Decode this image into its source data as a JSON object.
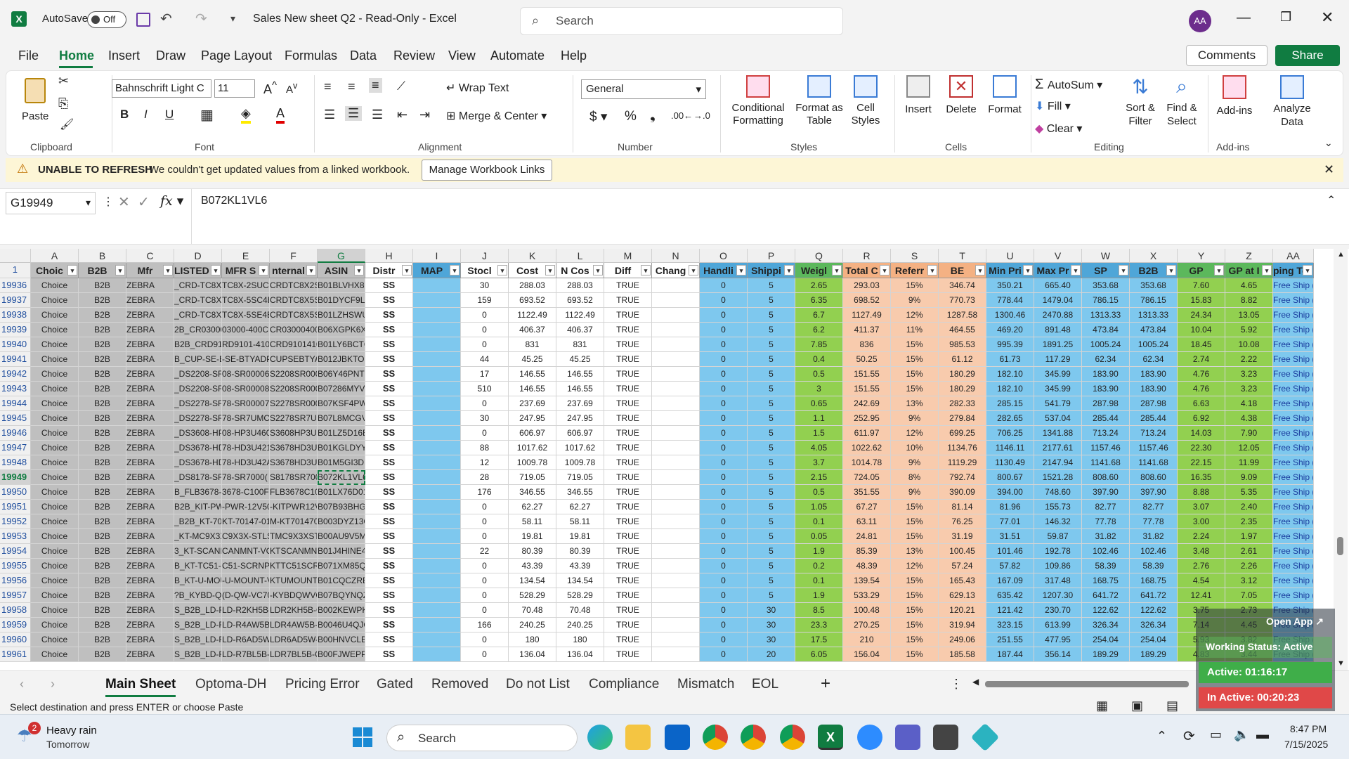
{
  "app": {
    "autosave": "AutoSave",
    "toggle": "Off",
    "title": "Sales New sheet Q2 - Read-Only - Excel",
    "search": "Search",
    "user": "AA"
  },
  "menu": [
    "File",
    "Home",
    "Insert",
    "Draw",
    "Page Layout",
    "Formulas",
    "Data",
    "Review",
    "View",
    "Automate",
    "Help"
  ],
  "comments": "Comments",
  "share": "Share",
  "ribbon": {
    "paste": "Paste",
    "clipboard": "Clipboard",
    "font_name": "Bahnschrift Light C",
    "font_size": "11",
    "font": "Font",
    "wrap": "Wrap Text",
    "merge": "Merge & Center",
    "alignment": "Alignment",
    "numfmt": "General",
    "number": "Number",
    "cond": "Conditional Formatting",
    "fmt_table": "Format as Table",
    "cell_styles": "Cell Styles",
    "styles": "Styles",
    "insert": "Insert",
    "delete": "Delete",
    "format": "Format",
    "cells": "Cells",
    "autosum": "AutoSum",
    "fill": "Fill",
    "clear": "Clear",
    "sort": "Sort & Filter",
    "find": "Find & Select",
    "editing": "Editing",
    "addins": "Add-ins",
    "addins_grp": "Add-ins",
    "analyze": "Analyze Data"
  },
  "warning": {
    "title": "UNABLE TO REFRESH",
    "msg": "We couldn't get updated values from a linked workbook.",
    "btn": "Manage Workbook Links"
  },
  "namebox": "G19949",
  "formula": "B072KL1VL6",
  "columns": [
    "A",
    "B",
    "C",
    "D",
    "E",
    "F",
    "G",
    "H",
    "I",
    "J",
    "K",
    "L",
    "M",
    "N",
    "O",
    "P",
    "Q",
    "R",
    "S",
    "T",
    "U",
    "V",
    "W",
    "X",
    "Y",
    "Z",
    "AA"
  ],
  "headers": [
    "Choic",
    "B2B",
    "Mfr",
    "LISTED SI",
    "MFR S",
    "nternal",
    "ASIN",
    "Distr",
    "MAP",
    "Stocl",
    "Cost",
    "N Cos",
    "Diff",
    "Chang",
    "Handli",
    "Shippi",
    "Weigl",
    "Total C",
    "Referr",
    "BE",
    "Min Pri",
    "Max Pr",
    "SP",
    "B2B",
    "GP",
    "GP at I",
    "ping Te"
  ],
  "rows": [
    [
      "19936",
      "Choice",
      "B2B",
      "ZEBRA",
      "_CRD-TC8X-2SU",
      "TC8X-2SUCH",
      "CRDTC8X2SUC",
      "B01BLVHX8S",
      "SS",
      "",
      "30",
      "288.03",
      "288.03",
      "TRUE",
      "",
      "0",
      "5",
      "2.65",
      "293.03",
      "15%",
      "346.74",
      "350.21",
      "665.40",
      "353.68",
      "353.68",
      "7.60",
      "4.65",
      "Free Ship ("
    ],
    [
      "19937",
      "Choice",
      "B2B",
      "ZEBRA",
      "_CRD-TC8X-5SC",
      "TC8X-5SC4E",
      "CRDTC8X5SC4",
      "B01DYCF9LK",
      "SS",
      "",
      "159",
      "693.52",
      "693.52",
      "TRUE",
      "",
      "0",
      "5",
      "6.35",
      "698.52",
      "9%",
      "770.73",
      "778.44",
      "1479.04",
      "786.15",
      "786.15",
      "15.83",
      "8.82",
      "Free Ship ("
    ],
    [
      "19938",
      "Choice",
      "B2B",
      "ZEBRA",
      "_CRD-TC8X-5SE",
      "TC8X-5SE4E",
      "CRDTC8X5SE4",
      "B01LZHSWUF",
      "SS",
      "",
      "0",
      "1122.49",
      "1122.49",
      "TRUE",
      "",
      "0",
      "5",
      "6.7",
      "1127.49",
      "12%",
      "1287.58",
      "1300.46",
      "2470.88",
      "1313.33",
      "1313.33",
      "24.34",
      "13.05",
      "Free Ship ("
    ],
    [
      "19939",
      "Choice",
      "B2B",
      "ZEBRA",
      "2B_CR03000-40",
      "03000-400C",
      "CR03000400",
      "B06XGPK6XK",
      "SS",
      "",
      "0",
      "406.37",
      "406.37",
      "TRUE",
      "",
      "0",
      "5",
      "6.2",
      "411.37",
      "11%",
      "464.55",
      "469.20",
      "891.48",
      "473.84",
      "473.84",
      "10.04",
      "5.92",
      "Free Ship ("
    ],
    [
      "19940",
      "Choice",
      "B2B",
      "ZEBRA",
      "B2B_CRD9101-41",
      "RD9101-410E",
      "CRD9101410",
      "B01LY6BCTQ",
      "SS",
      "",
      "0",
      "831",
      "831",
      "TRUE",
      "",
      "0",
      "5",
      "7.85",
      "836",
      "15%",
      "985.53",
      "995.39",
      "1891.25",
      "1005.24",
      "1005.24",
      "18.45",
      "10.08",
      "Free Ship ("
    ],
    [
      "19941",
      "Choice",
      "B2B",
      "ZEBRA",
      "B_CUP-SE-BTYAI",
      "-SE-BTYADP",
      "CUPSEBTYAI",
      "B012JBKTOS",
      "SS",
      "",
      "44",
      "45.25",
      "45.25",
      "TRUE",
      "",
      "0",
      "5",
      "0.4",
      "50.25",
      "15%",
      "61.12",
      "61.73",
      "117.29",
      "62.34",
      "62.34",
      "2.74",
      "2.22",
      "Free Ship ("
    ],
    [
      "19942",
      "Choice",
      "B2B",
      "ZEBRA",
      "_DS2208-SR000",
      "08-SR00006",
      "S2208SR000",
      "B06Y46PNTG",
      "SS",
      "",
      "17",
      "146.55",
      "146.55",
      "TRUE",
      "",
      "0",
      "5",
      "0.5",
      "151.55",
      "15%",
      "180.29",
      "182.10",
      "345.99",
      "183.90",
      "183.90",
      "4.76",
      "3.23",
      "Free Ship ("
    ],
    [
      "19943",
      "Choice",
      "B2B",
      "ZEBRA",
      "_DS2208-SR000",
      "08-SR00008",
      "S2208SR000",
      "B07286MYV4",
      "SS",
      "",
      "510",
      "146.55",
      "146.55",
      "TRUE",
      "",
      "0",
      "5",
      "3",
      "151.55",
      "15%",
      "180.29",
      "182.10",
      "345.99",
      "183.90",
      "183.90",
      "4.76",
      "3.23",
      "Free Ship ("
    ],
    [
      "19944",
      "Choice",
      "B2B",
      "ZEBRA",
      "_DS2278-SR000",
      "78-SR00007",
      "S2278SR000",
      "B07KSF4PWF",
      "SS",
      "",
      "0",
      "237.69",
      "237.69",
      "TRUE",
      "",
      "0",
      "5",
      "0.65",
      "242.69",
      "13%",
      "282.33",
      "285.15",
      "541.79",
      "287.98",
      "287.98",
      "6.63",
      "4.18",
      "Free Ship ("
    ],
    [
      "19945",
      "Choice",
      "B2B",
      "ZEBRA",
      "_DS2278-SR7UM",
      "78-SR7UMC0",
      "S2278SR7UM",
      "B07L8MCGVQ",
      "SS",
      "",
      "30",
      "247.95",
      "247.95",
      "TRUE",
      "",
      "0",
      "5",
      "1.1",
      "252.95",
      "9%",
      "279.84",
      "282.65",
      "537.04",
      "285.44",
      "285.44",
      "6.92",
      "4.38",
      "Free Ship ("
    ],
    [
      "19946",
      "Choice",
      "B2B",
      "ZEBRA",
      "_DS3608-HP3U4",
      "08-HP3U460",
      "S3608HP3U4",
      "B01LZ5D16E",
      "SS",
      "",
      "0",
      "606.97",
      "606.97",
      "TRUE",
      "",
      "0",
      "5",
      "1.5",
      "611.97",
      "12%",
      "699.25",
      "706.25",
      "1341.88",
      "713.24",
      "713.24",
      "14.03",
      "7.90",
      "Free Ship ("
    ],
    [
      "19947",
      "Choice",
      "B2B",
      "ZEBRA",
      "_DS3678-HD3U4",
      "78-HD3U421(",
      "S3678HD3U4",
      "B01KGLDYYG",
      "SS",
      "",
      "88",
      "1017.62",
      "1017.62",
      "TRUE",
      "",
      "0",
      "5",
      "4.05",
      "1022.62",
      "10%",
      "1134.76",
      "1146.11",
      "2177.61",
      "1157.46",
      "1157.46",
      "22.30",
      "12.05",
      "Free Ship ("
    ],
    [
      "19948",
      "Choice",
      "B2B",
      "ZEBRA",
      "_DS3678-HD3U4",
      "78-HD3U42A",
      "S3678HD3U4",
      "B01M5GI3DB",
      "SS",
      "",
      "12",
      "1009.78",
      "1009.78",
      "TRUE",
      "",
      "0",
      "5",
      "3.7",
      "1014.78",
      "9%",
      "1119.29",
      "1130.49",
      "2147.94",
      "1141.68",
      "1141.68",
      "22.15",
      "11.99",
      "Free Ship ("
    ],
    [
      "19949",
      "Choice",
      "B2B",
      "ZEBRA",
      "_DS8178-SR700",
      "78-SR7000(",
      "S8178SR700",
      "B072KL1VL6",
      "SS",
      "",
      "28",
      "719.05",
      "719.05",
      "TRUE",
      "",
      "0",
      "5",
      "2.15",
      "724.05",
      "8%",
      "792.74",
      "800.67",
      "1521.28",
      "808.60",
      "808.60",
      "16.35",
      "9.09",
      "Free Ship ("
    ],
    [
      "19950",
      "Choice",
      "B2B",
      "ZEBRA",
      "B_FLB3678-C100",
      "3678-C100F3",
      "FLB3678C100",
      "B01LX76D01",
      "SS",
      "",
      "176",
      "346.55",
      "346.55",
      "TRUE",
      "",
      "0",
      "5",
      "0.5",
      "351.55",
      "9%",
      "390.09",
      "394.00",
      "748.60",
      "397.90",
      "397.90",
      "8.88",
      "5.35",
      "Free Ship ("
    ],
    [
      "19951",
      "Choice",
      "B2B",
      "ZEBRA",
      "B2B_KIT-PWR-12V",
      "-PWR-12V50",
      "-KITPWR12V5",
      "B07B93BHGW",
      "SS",
      "",
      "0",
      "62.27",
      "62.27",
      "TRUE",
      "",
      "0",
      "5",
      "1.05",
      "67.27",
      "15%",
      "81.14",
      "81.96",
      "155.73",
      "82.77",
      "82.77",
      "3.07",
      "2.40",
      "Free Ship ("
    ],
    [
      "19952",
      "Choice",
      "B2B",
      "ZEBRA",
      "_B2B_KT-70147-",
      "KT-70147-01",
      "M-KT701470",
      "B003DYZ13G",
      "SS",
      "",
      "0",
      "58.11",
      "58.11",
      "TRUE",
      "",
      "0",
      "5",
      "0.1",
      "63.11",
      "15%",
      "76.25",
      "77.01",
      "146.32",
      "77.78",
      "77.78",
      "3.00",
      "2.35",
      "Free Ship ("
    ],
    [
      "19953",
      "Choice",
      "B2B",
      "ZEBRA",
      "_KT-MC9X3X-ST",
      "C9X3X-STLS",
      "TMC9X3XSTL",
      "B00AU9V5MS",
      "SS",
      "",
      "0",
      "19.81",
      "19.81",
      "TRUE",
      "",
      "0",
      "5",
      "0.05",
      "24.81",
      "15%",
      "31.19",
      "31.51",
      "59.87",
      "31.82",
      "31.82",
      "2.24",
      "1.97",
      "Free Ship ("
    ],
    [
      "19954",
      "Choice",
      "B2B",
      "ZEBRA",
      "3_KT-SCANMNT-V",
      "CANMNT-VCK",
      "KTSCANMNTV",
      "B01J4HINE4",
      "SS",
      "",
      "22",
      "80.39",
      "80.39",
      "TRUE",
      "",
      "0",
      "5",
      "1.9",
      "85.39",
      "13%",
      "100.45",
      "101.46",
      "192.78",
      "102.46",
      "102.46",
      "3.48",
      "2.61",
      "Free Ship ("
    ],
    [
      "19955",
      "Choice",
      "B2B",
      "ZEBRA",
      "B_KT-TC51-SCRN",
      "C51-SCRNP",
      "KTTC51SCRN",
      "B071XM85QD",
      "SS",
      "",
      "0",
      "43.39",
      "43.39",
      "TRUE",
      "",
      "0",
      "5",
      "0.2",
      "48.39",
      "12%",
      "57.24",
      "57.82",
      "109.86",
      "58.39",
      "58.39",
      "2.76",
      "2.26",
      "Free Ship ("
    ],
    [
      "19956",
      "Choice",
      "B2B",
      "ZEBRA",
      "B_KT-U-MOUNT-V",
      "-U-MOUNT-VC1",
      "KTUMOUNTV",
      "B01CQCZRBE",
      "SS",
      "",
      "0",
      "134.54",
      "134.54",
      "TRUE",
      "",
      "0",
      "5",
      "0.1",
      "139.54",
      "15%",
      "165.43",
      "167.09",
      "317.48",
      "168.75",
      "168.75",
      "4.54",
      "3.12",
      "Free Ship ("
    ],
    [
      "19957",
      "Choice",
      "B2B",
      "ZEBRA",
      "?B_KYBD-QW-VC7",
      "(D-QW-VC70-",
      "-KYBDQWVC7",
      "B07BQYNQZF",
      "SS",
      "",
      "0",
      "528.29",
      "528.29",
      "TRUE",
      "",
      "0",
      "5",
      "1.9",
      "533.29",
      "15%",
      "629.13",
      "635.42",
      "1207.30",
      "641.72",
      "641.72",
      "12.41",
      "7.05",
      "Free Ship ("
    ],
    [
      "19958",
      "Choice",
      "B2B",
      "ZEBRA",
      "S_B2B_LD-R2KH5",
      "LD-R2KH5B-",
      "LDR2KH5B-C",
      "B002KEWPKM",
      "SS",
      "",
      "0",
      "70.48",
      "70.48",
      "TRUE",
      "",
      "0",
      "30",
      "8.5",
      "100.48",
      "15%",
      "120.21",
      "121.42",
      "230.70",
      "122.62",
      "122.62",
      "3.75",
      "2.73",
      "Free Ship ("
    ],
    [
      "19959",
      "Choice",
      "B2B",
      "ZEBRA",
      "S_B2B_LD-R4AW5",
      "LD-R4AW5B-",
      "LDR4AW5B-C",
      "B0046U4QJQ",
      "SS",
      "",
      "166",
      "240.25",
      "240.25",
      "TRUE",
      "",
      "0",
      "30",
      "23.3",
      "270.25",
      "15%",
      "319.94",
      "323.15",
      "613.99",
      "326.34",
      "326.34",
      "7.14",
      "4.45",
      "Free Ship ("
    ],
    [
      "19960",
      "Choice",
      "B2B",
      "ZEBRA",
      "S_B2B_LD-R6AD5",
      "LD-R6AD5W-",
      "LDR6AD5W-C",
      "B00HNVCLBK",
      "SS",
      "",
      "0",
      "180",
      "180",
      "TRUE",
      "",
      "0",
      "30",
      "17.5",
      "210",
      "15%",
      "249.06",
      "251.55",
      "477.95",
      "254.04",
      "254.04",
      "5.93",
      "3.82",
      "Free Ship ("
    ],
    [
      "19961",
      "Choice",
      "B2B",
      "ZEBRA",
      "S_B2B_LD-R7BL5",
      "LD-R7BL5B-",
      "LDR7BL5B-C",
      "B00FJWEPPK",
      "SS",
      "",
      "0",
      "136.04",
      "136.04",
      "TRUE",
      "",
      "0",
      "20",
      "6.05",
      "156.04",
      "15%",
      "185.58",
      "187.44",
      "356.14",
      "189.29",
      "189.29",
      "4.83",
      "3.44",
      "Free Ship ("
    ]
  ],
  "sheets": [
    "Main Sheet",
    "Optoma-DH",
    "Pricing Error",
    "Gated",
    "Removed",
    "Do not List",
    "Compliance",
    "Mismatch",
    "EOL"
  ],
  "status": "Select destination and press ENTER or choose Paste",
  "overlay": {
    "open": "Open App",
    "working": "Working Status: Active",
    "active": "Active: 01:16:17",
    "inactive": "In Active: 00:20:23"
  },
  "weather": {
    "badge": "2",
    "title": "Heavy rain",
    "sub": "Tomorrow"
  },
  "taskbar_search": "Search",
  "clock": {
    "time": "8:47 PM",
    "date": "7/15/2025"
  },
  "colors": {
    "excel_green": "#107c41",
    "header_blue": "#4fa6d8",
    "header_orange": "#f4b183",
    "header_green": "#5cb85c",
    "cell_green": "#92d050",
    "cell_orange": "#f8cbad",
    "cell_blue": "#7ec8ee",
    "cell_gray": "#bfbfbf"
  }
}
